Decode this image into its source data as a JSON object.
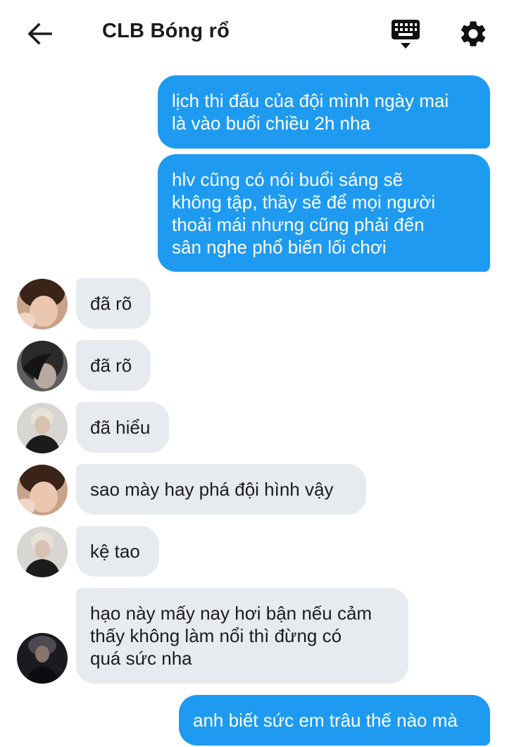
{
  "header": {
    "title": "CLB Bóng rổ",
    "back_icon": "arrow-left-icon",
    "keyboard_icon": "keyboard-icon",
    "settings_icon": "gear-icon"
  },
  "colors": {
    "outgoing_bubble": "#1e9bf0",
    "incoming_bubble": "#e7ebf0"
  },
  "messages": [
    {
      "direction": "out",
      "lines": [
        "lịch thi đấu của đội mình ngày mai",
        "là vào buổi chiều 2h nha"
      ]
    },
    {
      "direction": "out",
      "lines": [
        "hlv cũng có nói buổi sáng sẽ",
        "không tập, thầy sẽ để mọi người",
        "thoải mái nhưng cũng phải đến",
        "sân nghe phổ biến lối chơi"
      ]
    },
    {
      "direction": "in",
      "lines": [
        "đã rõ"
      ]
    },
    {
      "direction": "in",
      "lines": [
        "đã rõ"
      ]
    },
    {
      "direction": "in",
      "lines": [
        "đã hiểu"
      ]
    },
    {
      "direction": "in",
      "lines": [
        "sao mày hay phá đội hình vậy"
      ]
    },
    {
      "direction": "in",
      "lines": [
        "kệ tao"
      ]
    },
    {
      "direction": "in",
      "lines": [
        "hạo này mấy nay hơi bận nếu cảm",
        "thấy không làm nổi thì đừng có",
        "quá sức nha"
      ]
    },
    {
      "direction": "out",
      "lines": [
        "anh biết sức em trâu thế nào mà"
      ]
    }
  ]
}
